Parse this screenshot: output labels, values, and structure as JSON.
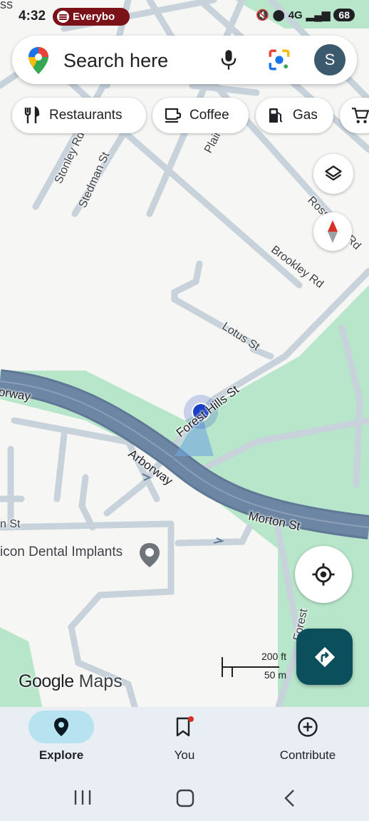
{
  "status_bar": {
    "time": "4:32",
    "media_title": "Everybo",
    "network": "4G",
    "battery": "68"
  },
  "search": {
    "placeholder": "Search here",
    "avatar_initial": "S"
  },
  "chips": [
    {
      "label": "Restaurants",
      "icon": "fork-knife-icon"
    },
    {
      "label": "Coffee",
      "icon": "coffee-cup-icon"
    },
    {
      "label": "Gas",
      "icon": "gas-pump-icon"
    },
    {
      "label": "",
      "icon": "shopping-cart-icon"
    }
  ],
  "map": {
    "streets": {
      "brookley": "Brookley Rd",
      "lotus": "Lotus St",
      "forest_hills": "Forest Hills St",
      "arborway_left": "orway",
      "arborway": "Arborway",
      "morton": "Morton St",
      "stedman": "Stedman St",
      "stonley": "Stonley Rd",
      "rossmore": "Rossmore Rd",
      "plainfield": "Plainfield St",
      "forest_bottom": "Forest",
      "st_left": "n St",
      "top_left": "ss"
    },
    "poi": "icon Dental Implants",
    "scale_ft": "200 ft",
    "scale_m": "50 m",
    "logo_google": "Google",
    "logo_maps": "Maps",
    "colors": {
      "park": "#b8e6cb",
      "highway": "#6d86a3",
      "road": "#c7d2db",
      "location_dot": "#1a3fc4"
    }
  },
  "bottom_nav": [
    {
      "label": "Explore",
      "icon": "explore-pin-icon",
      "active": true
    },
    {
      "label": "You",
      "icon": "bookmark-icon",
      "active": false
    },
    {
      "label": "Contribute",
      "icon": "add-circle-icon",
      "active": false
    }
  ]
}
